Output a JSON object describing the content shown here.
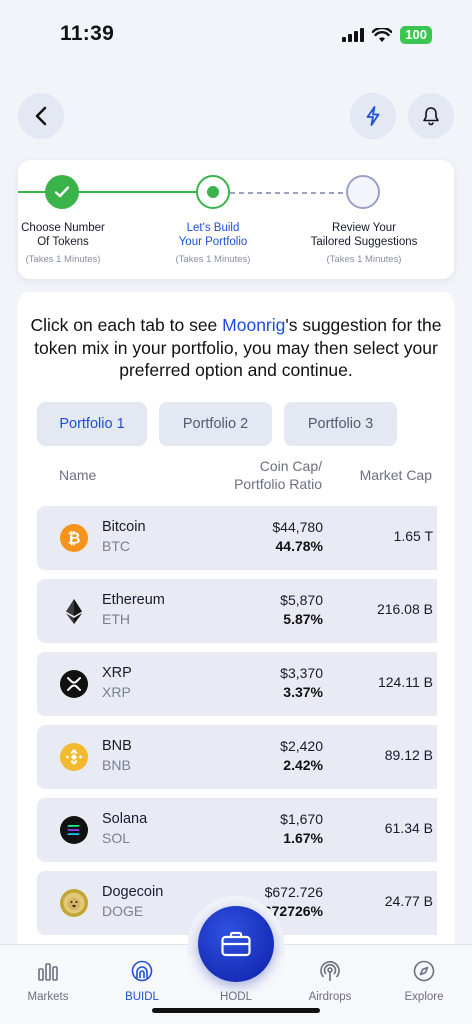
{
  "status": {
    "time": "11:39",
    "battery": "100"
  },
  "header": {
    "back_icon": "chevron-left-icon",
    "bolt_icon": "lightning-icon",
    "bell_icon": "bell-icon"
  },
  "stepper": {
    "steps": [
      {
        "title_line1": "Choose Number",
        "title_line2": "Of Tokens",
        "sub": "(Takes 1 Minutes)",
        "state": "done"
      },
      {
        "title_line1": "Let's Build",
        "title_line2": "Your Portfolio",
        "sub": "(Takes 1 Minutes)",
        "state": "active"
      },
      {
        "title_line1": "Review Your",
        "title_line2": "Tailored Suggestions",
        "sub": "(Takes 1 Minutes)",
        "state": "pending"
      }
    ]
  },
  "intro": {
    "before": "Click on each tab to see ",
    "brand": "Moonrig",
    "after": "'s suggestion for the token mix in your portfolio, you may then select your preferred option and continue."
  },
  "tabs": [
    "Portfolio 1",
    "Portfolio 2",
    "Portfolio 3"
  ],
  "table": {
    "col_name": "Name",
    "col_cap_line1": "Coin Cap/",
    "col_cap_line2": "Portfolio Ratio",
    "col_mcap": "Market Cap",
    "rows": [
      {
        "name": "Bitcoin",
        "symbol": "BTC",
        "cap": "$44,780",
        "ratio": "44.78%",
        "mcap": "1.65 T",
        "icon": "bitcoin-icon",
        "color": "#f7931a"
      },
      {
        "name": "Ethereum",
        "symbol": "ETH",
        "cap": "$5,870",
        "ratio": "5.87%",
        "mcap": "216.08 B",
        "icon": "ethereum-icon",
        "color": "#3c3c3d"
      },
      {
        "name": "XRP",
        "symbol": "XRP",
        "cap": "$3,370",
        "ratio": "3.37%",
        "mcap": "124.11 B",
        "icon": "xrp-icon",
        "color": "#111111"
      },
      {
        "name": "BNB",
        "symbol": "BNB",
        "cap": "$2,420",
        "ratio": "2.42%",
        "mcap": "89.12 B",
        "icon": "bnb-icon",
        "color": "#f3ba2f"
      },
      {
        "name": "Solana",
        "symbol": "SOL",
        "cap": "$1,670",
        "ratio": "1.67%",
        "mcap": "61.34 B",
        "icon": "solana-icon",
        "color": "#111111"
      },
      {
        "name": "Dogecoin",
        "symbol": "DOGE",
        "cap": "$672.726",
        "ratio": "0.672726%",
        "mcap": "24.77 B",
        "icon": "dogecoin-icon",
        "color": "#c2a633"
      }
    ]
  },
  "nav": {
    "items": [
      {
        "label": "Markets",
        "icon": "bar-chart-icon"
      },
      {
        "label": "BUIDL",
        "icon": "buidl-icon"
      },
      {
        "label": "HODL",
        "icon": "briefcase-icon"
      },
      {
        "label": "Airdrops",
        "icon": "broadcast-icon"
      },
      {
        "label": "Explore",
        "icon": "compass-icon"
      }
    ],
    "active": "BUIDL"
  },
  "colors": {
    "accent": "#1f4fd6",
    "done": "#3ab44a",
    "fab": "#0c1fa8"
  }
}
